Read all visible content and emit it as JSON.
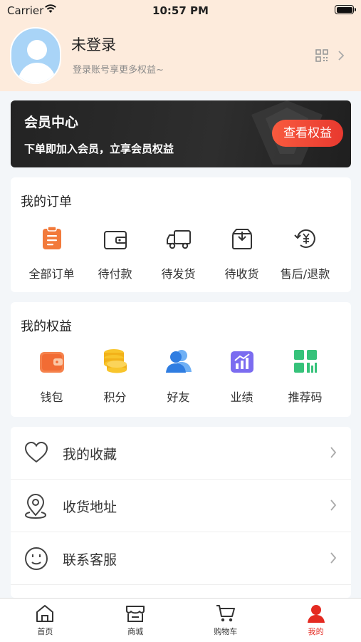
{
  "status_bar": {
    "carrier": "Carrier",
    "time": "10:57 PM"
  },
  "header": {
    "username": "未登录",
    "subtitle": "登录账号享更多权益~",
    "background": "#fdebdc"
  },
  "member_banner": {
    "title": "会员中心",
    "subtitle": "下单即加入会员，立享会员权益",
    "button_label": "查看权益"
  },
  "orders": {
    "title": "我的订单",
    "items": [
      {
        "label": "全部订单",
        "icon": "clipboard-icon"
      },
      {
        "label": "待付款",
        "icon": "wallet-icon"
      },
      {
        "label": "待发货",
        "icon": "truck-icon"
      },
      {
        "label": "待收货",
        "icon": "inbox-icon"
      },
      {
        "label": "售后/退款",
        "icon": "refund-icon"
      }
    ]
  },
  "benefits": {
    "title": "我的权益",
    "items": [
      {
        "label": "钱包",
        "icon": "wallet-icon"
      },
      {
        "label": "积分",
        "icon": "coins-icon"
      },
      {
        "label": "好友",
        "icon": "friends-icon"
      },
      {
        "label": "业绩",
        "icon": "chart-icon"
      },
      {
        "label": "推荐码",
        "icon": "qrcode-icon"
      }
    ]
  },
  "menu": [
    {
      "label": "我的收藏",
      "icon": "heart-icon"
    },
    {
      "label": "收货地址",
      "icon": "location-icon"
    },
    {
      "label": "联系客服",
      "icon": "smile-icon"
    }
  ],
  "tab_bar": {
    "items": [
      {
        "label": "首页",
        "icon": "home-icon"
      },
      {
        "label": "商城",
        "icon": "store-icon"
      },
      {
        "label": "购物车",
        "icon": "cart-icon"
      },
      {
        "label": "我的",
        "icon": "user-icon",
        "active": true
      }
    ]
  },
  "colors": {
    "accent": "#e42a21",
    "orange": "#f27a3b",
    "yellow": "#f5b91c",
    "blue": "#3a86e8",
    "purple": "#7b6cf0",
    "green": "#36c27a"
  }
}
